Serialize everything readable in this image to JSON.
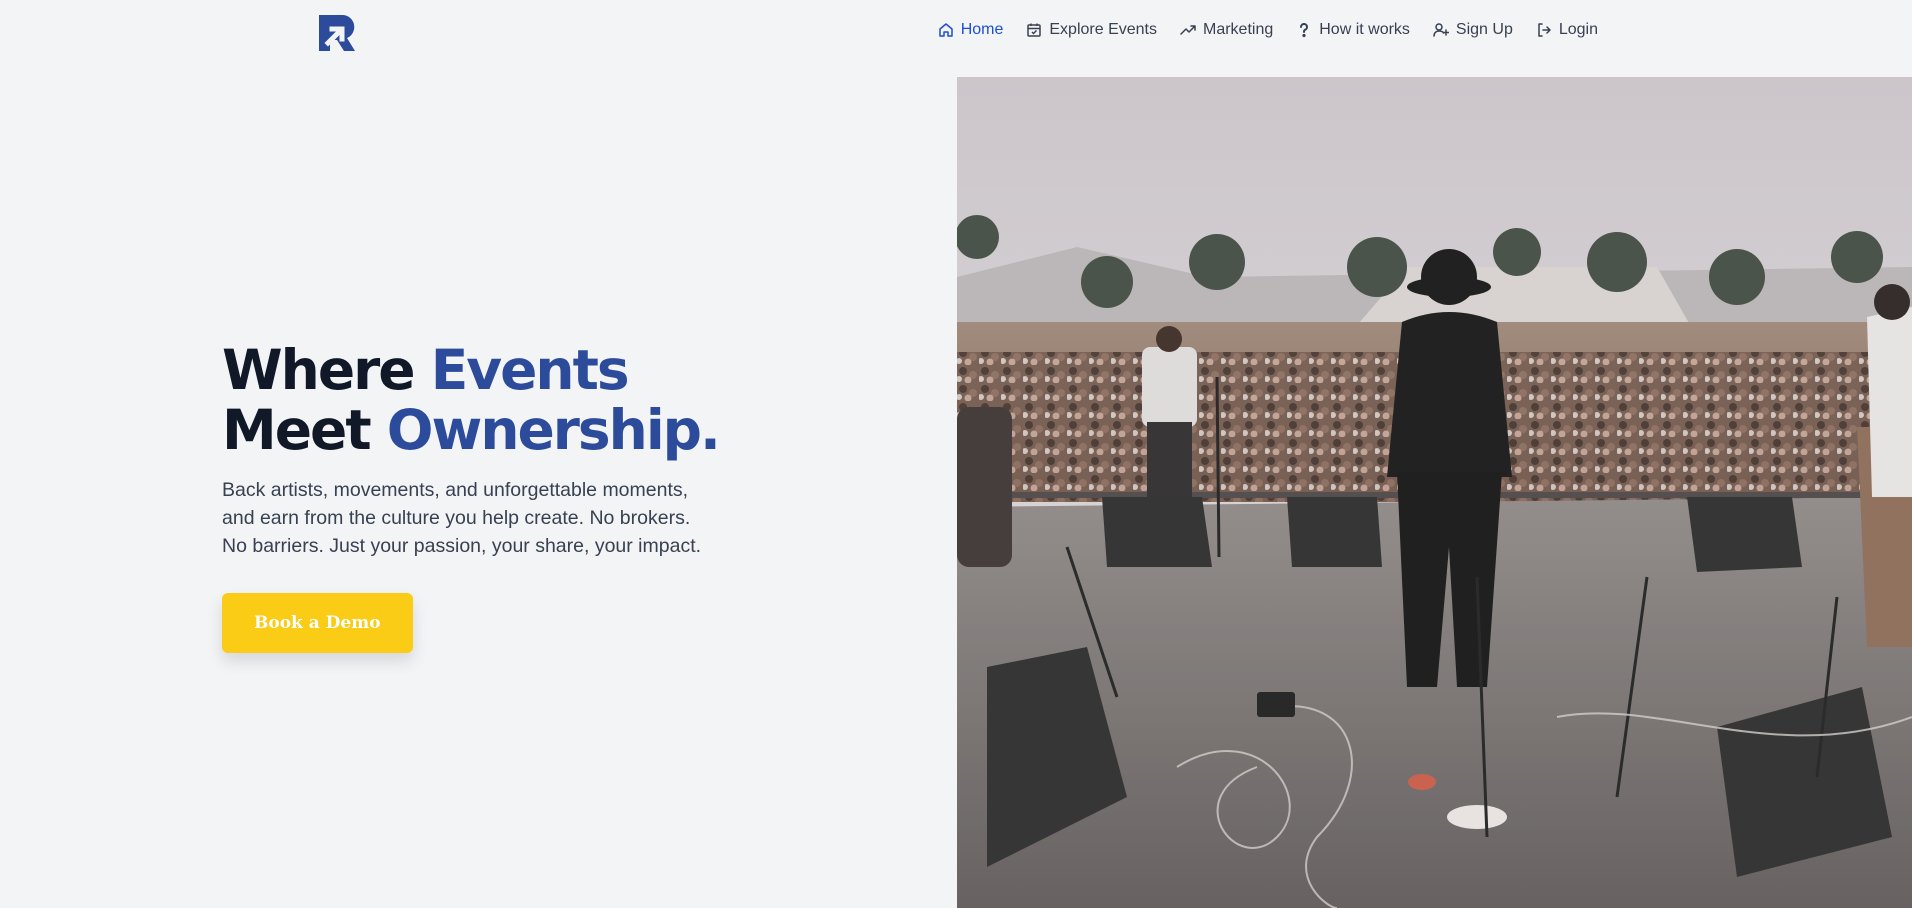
{
  "brand": {
    "logo_icon": "r-arrow-logo-icon",
    "color": "#2c4b9a"
  },
  "nav": {
    "items": [
      {
        "label": "Home",
        "icon": "home-icon",
        "active": true
      },
      {
        "label": "Explore Events",
        "icon": "calendar-icon",
        "active": false
      },
      {
        "label": "Marketing",
        "icon": "trending-up-icon",
        "active": false
      },
      {
        "label": "How it works",
        "icon": "question-icon",
        "active": false
      },
      {
        "label": "Sign Up",
        "icon": "user-plus-icon",
        "active": false
      },
      {
        "label": "Login",
        "icon": "login-icon",
        "active": false
      }
    ],
    "active_color": "#1d4ed8"
  },
  "hero": {
    "title_line1_a": "Where ",
    "title_line1_b": "Events",
    "title_line2_a": "Meet ",
    "title_line2_b": "Ownership.",
    "subtitle_line1": "Back artists, movements, and unforgettable moments,",
    "subtitle_line2": "and earn from the culture you help create. No brokers.",
    "subtitle_line3": "No barriers. Just your passion, your share, your impact.",
    "cta_label": "Book a Demo",
    "cta_color": "#facc15"
  }
}
